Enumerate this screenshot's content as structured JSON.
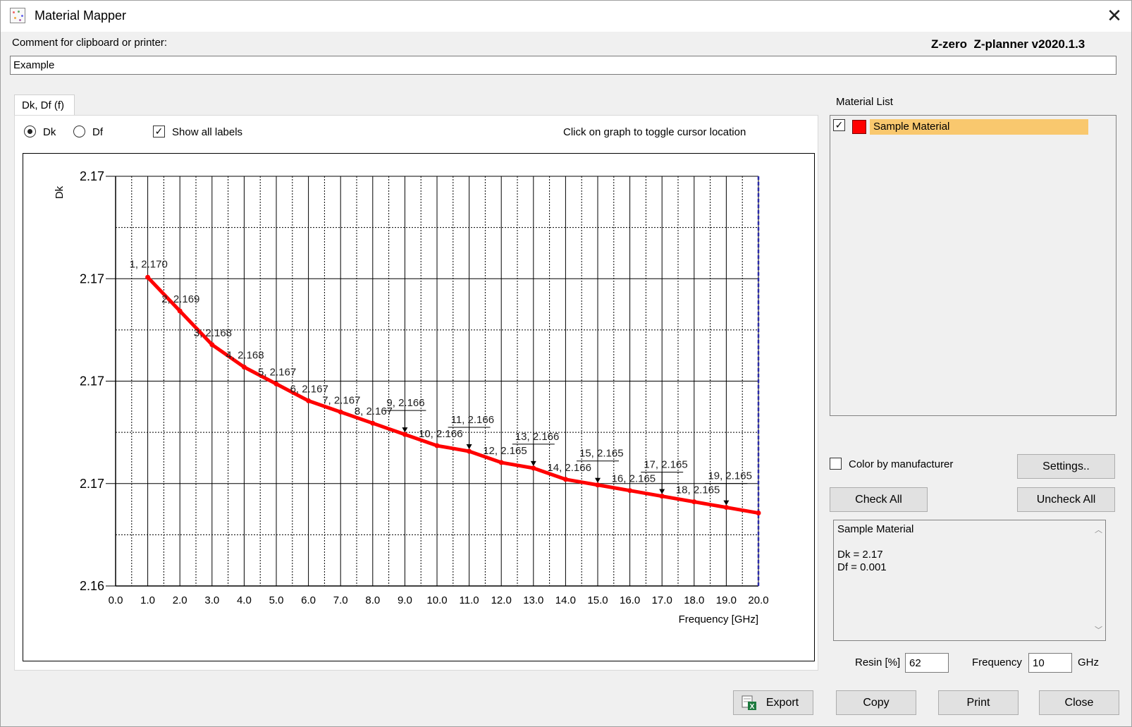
{
  "window": {
    "title": "Material Mapper",
    "close_glyph": "✕",
    "icon": "material-mapper-app-icon"
  },
  "header": {
    "comment_label": "Comment for clipboard or printer:",
    "version": "Z-zero  Z-planner v2020.1.3"
  },
  "comment": {
    "value": "Example "
  },
  "tabs": [
    {
      "label": "Dk, Df  (f)"
    }
  ],
  "options": {
    "radio_dk": "Dk",
    "radio_df": "Df",
    "selected": "Dk",
    "show_all_labels": "Show all labels",
    "show_all_labels_checked": true,
    "hint": "Click on graph to toggle cursor location"
  },
  "chart_data": {
    "type": "line",
    "xlabel": "Frequency [GHz]",
    "ylabel": "Dk",
    "xlim": [
      0,
      20
    ],
    "x_ticks": [
      "0.0",
      "1.0",
      "2.0",
      "3.0",
      "4.0",
      "5.0",
      "6.0",
      "7.0",
      "8.0",
      "9.0",
      "10.0",
      "11.0",
      "12.0",
      "13.0",
      "14.0",
      "15.0",
      "16.0",
      "17.0",
      "18.0",
      "19.0",
      "20.0"
    ],
    "y_ticks": [
      "2.17",
      "2.17",
      "2.17",
      "2.17",
      "2.16"
    ],
    "grid": true,
    "series": [
      {
        "color": "#ff0000",
        "x": [
          1,
          2,
          3,
          4,
          5,
          6,
          7,
          8,
          9,
          10,
          11,
          12,
          13,
          14,
          15,
          16,
          17,
          18,
          19,
          20
        ],
        "y": [
          2.17,
          2.1694,
          2.1688,
          2.1684,
          2.1681,
          2.1678,
          2.1676,
          2.1674,
          2.1672,
          2.167,
          2.1669,
          2.1667,
          2.1666,
          2.1664,
          2.1663,
          2.1662,
          2.1661,
          2.166,
          2.1659,
          2.1658
        ],
        "labels": [
          "1, 2.170",
          "2, 2.169",
          "3, 2.168",
          "4, 2.168",
          "5, 2.167",
          "6, 2.167",
          "7, 2.167",
          "8, 2.167",
          "9, 2.166",
          "10, 2.166",
          "11, 2.166",
          "12, 2.165",
          "13, 2.166",
          "14, 2.166",
          "15, 2.165",
          "16, 2.165",
          "17, 2.165",
          "18, 2.165",
          "19, 2.165"
        ]
      }
    ],
    "cursor_x": 20
  },
  "material_list": {
    "label": "Material List",
    "items": [
      {
        "name": "Sample Material",
        "checked": true,
        "color": "#ff0000"
      }
    ]
  },
  "controls": {
    "color_by_manufacturer": "Color by manufacturer",
    "settings": "Settings..",
    "check_all": "Check All",
    "uncheck_all": "Uncheck All"
  },
  "info": {
    "name": "Sample Material",
    "dk_line": "Dk = 2.17",
    "df_line": "Df = 0.001"
  },
  "params": {
    "resin_label": "Resin [%]",
    "resin_value": "62",
    "frequency_label": "Frequency",
    "frequency_value": "10",
    "frequency_unit": "GHz"
  },
  "buttons": {
    "export": "Export",
    "copy": "Copy",
    "print": "Print",
    "close": "Close"
  }
}
